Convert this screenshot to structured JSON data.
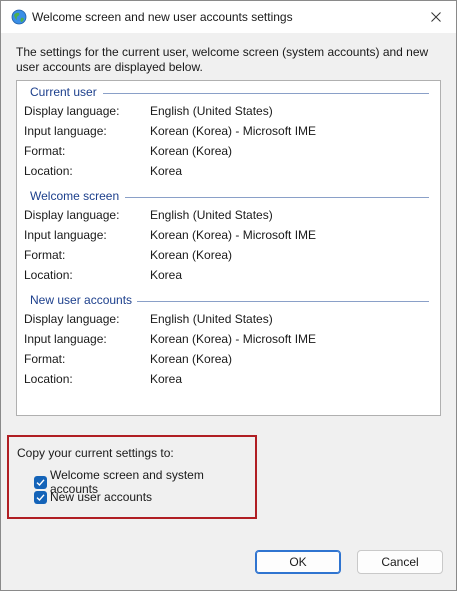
{
  "window": {
    "title": "Welcome screen and new user accounts settings",
    "close_icon": "close-icon",
    "app_icon": "globe-icon"
  },
  "intro_text": "The settings for the current user, welcome screen (system accounts) and new user accounts are displayed below.",
  "sections": [
    {
      "title": "Current user",
      "rows": [
        {
          "label": "Display language:",
          "value": "English (United States)"
        },
        {
          "label": "Input language:",
          "value": "Korean (Korea) - Microsoft IME"
        },
        {
          "label": "Format:",
          "value": "Korean (Korea)"
        },
        {
          "label": "Location:",
          "value": "Korea"
        }
      ]
    },
    {
      "title": "Welcome screen",
      "rows": [
        {
          "label": "Display language:",
          "value": "English (United States)"
        },
        {
          "label": "Input language:",
          "value": "Korean (Korea) - Microsoft IME"
        },
        {
          "label": "Format:",
          "value": "Korean (Korea)"
        },
        {
          "label": "Location:",
          "value": "Korea"
        }
      ]
    },
    {
      "title": "New user accounts",
      "rows": [
        {
          "label": "Display language:",
          "value": "English (United States)"
        },
        {
          "label": "Input language:",
          "value": "Korean (Korea) - Microsoft IME"
        },
        {
          "label": "Format:",
          "value": "Korean (Korea)"
        },
        {
          "label": "Location:",
          "value": "Korea"
        }
      ]
    }
  ],
  "copy": {
    "label": "Copy your current settings to:",
    "options": [
      {
        "label": "Welcome screen and system accounts",
        "checked": true
      },
      {
        "label": "New user accounts",
        "checked": true
      }
    ]
  },
  "buttons": {
    "ok": "OK",
    "cancel": "Cancel"
  },
  "colors": {
    "section_title": "#1c3f8c",
    "checkbox": "#1463b8",
    "highlight_border": "#b01e23",
    "primary_border": "#2f74d0"
  }
}
